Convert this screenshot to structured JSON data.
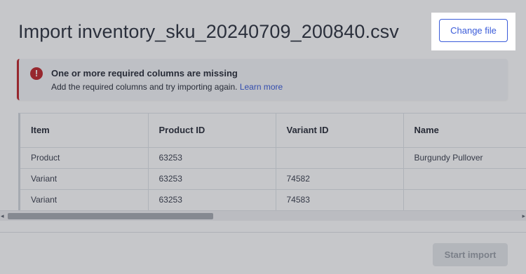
{
  "header": {
    "title": "Import inventory_sku_20240709_200840.csv",
    "change_file_label": "Change file"
  },
  "alert": {
    "type": "error",
    "icon": "error-icon",
    "icon_glyph": "!",
    "title": "One or more required columns are missing",
    "message": "Add the required columns and try importing again.",
    "link_text": "Learn more",
    "color": "#c0282d"
  },
  "table": {
    "columns": [
      "Item",
      "Product ID",
      "Variant ID",
      "Name"
    ],
    "rows": [
      [
        "Product",
        "63253",
        "",
        "Burgundy Pullover"
      ],
      [
        "Variant",
        "63253",
        "74582",
        ""
      ],
      [
        "Variant",
        "63253",
        "74583",
        ""
      ]
    ]
  },
  "scrollbar": {
    "left_arrow": "◂",
    "right_arrow": "▸"
  },
  "footer": {
    "start_import_label": "Start import",
    "start_import_enabled": false
  },
  "colors": {
    "accent": "#3a5bd9",
    "error": "#c0282d",
    "overlay": "rgba(35, 40, 50, 0.26)"
  }
}
